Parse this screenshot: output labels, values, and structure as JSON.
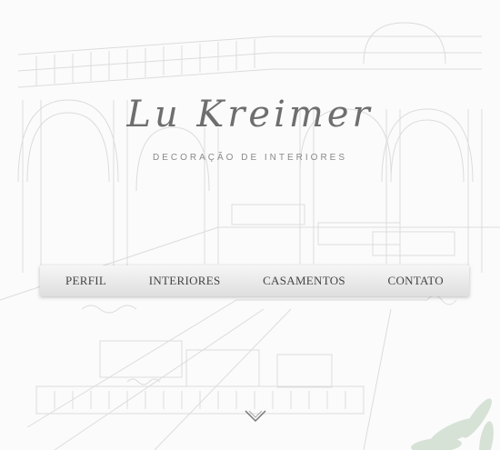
{
  "brand": {
    "name": "Lu Kreimer",
    "tagline": "DECORAÇÃO DE INTERIORES"
  },
  "nav": {
    "items": [
      "PERFIL",
      "INTERIORES",
      "CASAMENTOS",
      "CONTATO"
    ]
  },
  "icons": {
    "scroll": "chevron-down-icon",
    "background": "interior-sketch-illustration",
    "plant": "plant-leaves-decoration"
  },
  "colors": {
    "background": "#fbfbfb",
    "sketch_line": "#d9d9d9",
    "logo_text": "#6e6e6e",
    "nav_text": "#444444"
  }
}
